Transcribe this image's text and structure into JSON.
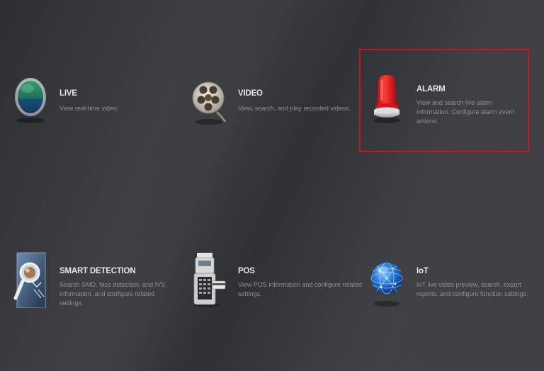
{
  "tiles": [
    {
      "id": "live",
      "title": "LIVE",
      "description": "View real-time video.",
      "icon": "live-monitor-icon"
    },
    {
      "id": "video",
      "title": "VIDEO",
      "description": "View, search, and play recorded videos.",
      "icon": "film-reel-icon"
    },
    {
      "id": "alarm",
      "title": "ALARM",
      "description": "View and search live alarm information. Configure alarm event actions.",
      "icon": "alarm-light-icon"
    },
    {
      "id": "smart_detection",
      "title": "SMART DETECTION",
      "description": "Search SMD, face detection, and IVS information, and configure related settings.",
      "icon": "magnifier-icon"
    },
    {
      "id": "pos",
      "title": "POS",
      "description": "View POS information and configure related settings.",
      "icon": "pos-terminal-icon"
    },
    {
      "id": "iot",
      "title": "IoT",
      "description": "IoT live video preview, search, export reports, and configure function settings.",
      "icon": "globe-icon"
    }
  ],
  "selected_tile": "alarm",
  "colors": {
    "selection_border": "#c8161a",
    "title_text": "#e6e6e6",
    "description_text": "#8f9094"
  }
}
